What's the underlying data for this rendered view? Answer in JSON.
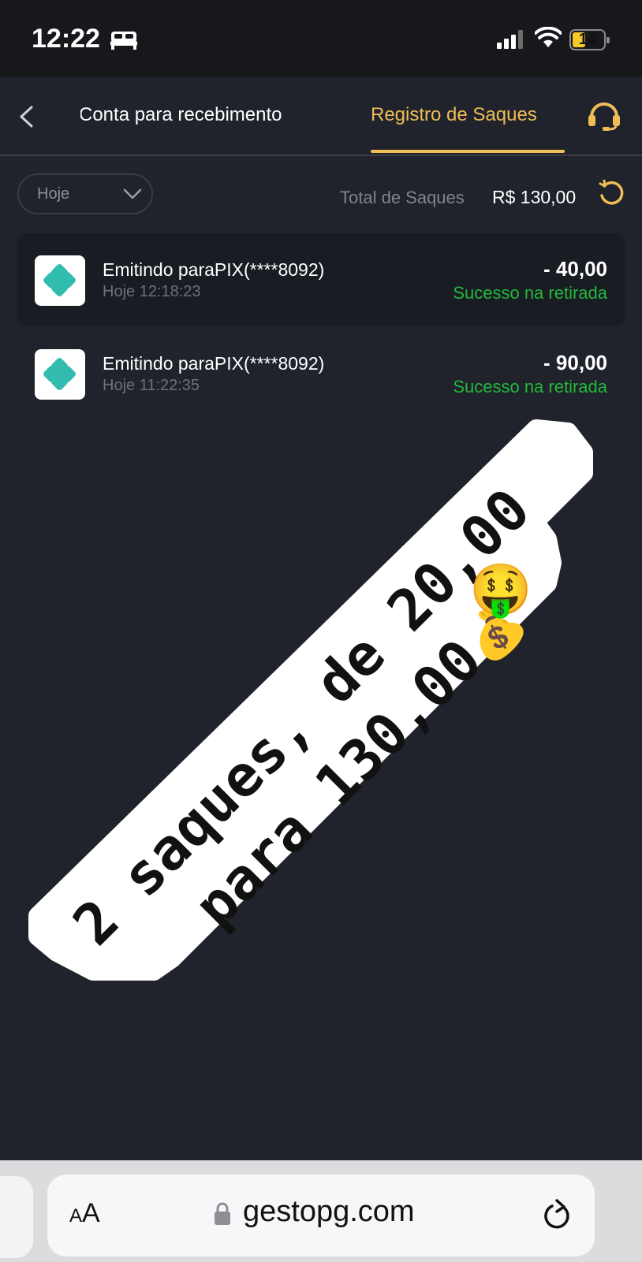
{
  "status_bar": {
    "time": "12:22",
    "battery": "14"
  },
  "header": {
    "back_icon": "chevron-left-icon",
    "tabs": [
      {
        "label": "Conta para recebimento",
        "active": false
      },
      {
        "label": "Registro de Saques",
        "active": true
      }
    ],
    "support_icon": "headset-icon",
    "accent_color": "#f0bd56"
  },
  "filter": {
    "selected": "Hoje"
  },
  "summary": {
    "label": "Total de Saques",
    "value": "R$ 130,00"
  },
  "withdrawals": [
    {
      "title": "Emitindo paraPIX(****8092)",
      "time": "Hoje 12:18:23",
      "amount": "- 40,00",
      "status": "Sucesso na retirada"
    },
    {
      "title": "Emitindo paraPIX(****8092)",
      "time": "Hoje 11:22:35",
      "amount": "- 90,00",
      "status": "Sucesso na retirada"
    }
  ],
  "sticker": {
    "line1": "2 saques, de 20,00",
    "line2": "para 130,00",
    "emoji1": "🤑",
    "emoji2": "💰"
  },
  "browser": {
    "aa_small": "A",
    "aa_large": "A",
    "url": "gestopg.com"
  },
  "colors": {
    "success": "#22b83a",
    "background": "#20232c"
  }
}
